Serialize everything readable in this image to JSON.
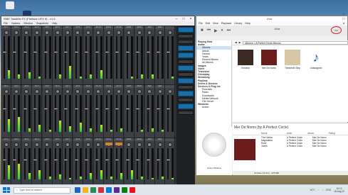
{
  "desktop": {
    "icons": [
      {
        "label": "",
        "color": "#e9edf2"
      },
      {
        "label": "",
        "color": "#1b3a69"
      }
    ]
  },
  "totalmix": {
    "title": "RME TotalMix FX (Fireface UFX II) - v1.6",
    "menu": [
      "File",
      "Options",
      "Window",
      "Snapshots",
      "Help"
    ],
    "accent_meter": "#1fcf35",
    "accent_button": "#d9822b",
    "panel_blue": "#1a6fa8",
    "row_labels": [
      "AN 1",
      "AN 2",
      "AN 3",
      "AN 4",
      "AN 5",
      "AN 6",
      "AN 7",
      "AN 8",
      "AN 9",
      "AN 10",
      "AN 11",
      "AN 12",
      "ADAT",
      "ADAT",
      "AES",
      "AES"
    ]
  },
  "foobar": {
    "title": "Aria",
    "menu": [
      "File",
      "Edit",
      "View",
      "Playback",
      "Library",
      "Help"
    ],
    "toolbar_icons": [
      "stop-icon",
      "previous-icon",
      "play-icon",
      "pause-icon",
      "next-icon"
    ],
    "volume_label": "Vol",
    "sidebar": [
      {
        "label": "Playing Now",
        "type": "hd"
      },
      {
        "label": "Audio",
        "type": "hd"
      },
      {
        "label": "Albums",
        "type": "sub",
        "selected": true
      },
      {
        "label": "Artists",
        "type": "sub"
      },
      {
        "label": "Genres",
        "type": "sub"
      },
      {
        "label": "Years",
        "type": "sub"
      },
      {
        "label": "Recent Albums",
        "type": "sub"
      },
      {
        "label": "All Albums",
        "type": "sub"
      },
      {
        "label": "Images",
        "type": "hd"
      },
      {
        "label": "Video",
        "type": "hd"
      },
      {
        "label": "Television",
        "type": "hd"
      },
      {
        "label": "Cloudplay",
        "type": "hd"
      },
      {
        "label": "Streaming",
        "type": "hd"
      },
      {
        "label": "Playlists",
        "type": "hd"
      },
      {
        "label": "Drives & Devices",
        "type": "hd"
      },
      {
        "label": "Services & Plug-ins",
        "type": "hd"
      },
      {
        "label": "Podcasts",
        "type": "sub"
      },
      {
        "label": "Radio",
        "type": "sub"
      },
      {
        "label": "Downloads",
        "type": "sub"
      },
      {
        "label": "Media Network",
        "type": "sub"
      },
      {
        "label": "File Server",
        "type": "sub"
      },
      {
        "label": "Windows",
        "type": "hd"
      },
      {
        "label": "Action",
        "type": "sub"
      }
    ],
    "breadcrumb": "Albums > A Perfect Circle Albums",
    "albums": [
      {
        "name": "Emotive",
        "color": "#3a2a22"
      },
      {
        "name": "Mer De Noms",
        "color": "#6b1c1c"
      },
      {
        "name": "Thirteenth Step",
        "color": "#d7c7a6"
      },
      {
        "name": "Unassigned",
        "color": "#ffffff"
      }
    ],
    "viz_label": "Action Window",
    "panel_title": "Mer De Noms (by A Perfect Circle)",
    "columns": [
      "Name",
      "Artist",
      "Album",
      "Rating"
    ],
    "tracks": [
      {
        "name": "The Hollow",
        "artist": "A Perfect Circle",
        "album": "Mer De Noms"
      },
      {
        "name": "Magdalena",
        "artist": "A Perfect Circle",
        "album": "Mer De Noms"
      },
      {
        "name": "Rose",
        "artist": "A Perfect Circle",
        "album": "Mer De Noms"
      },
      {
        "name": "Judith",
        "artist": "A Perfect Circle",
        "album": "Mer De Noms"
      }
    ],
    "status": "12 Files (1h 0m) - 475 MB"
  },
  "taskbar": {
    "search_placeholder": "Type here to search",
    "apps": [
      "#1e66c5",
      "#f3b51b",
      "#2e8b57",
      "#d13438",
      "#0078d4",
      "#5c2d91",
      "#107c10",
      "#e81123"
    ],
    "weather": "16°C",
    "lang": "ENG",
    "time": "10:12",
    "date": "18-Aug-22"
  }
}
